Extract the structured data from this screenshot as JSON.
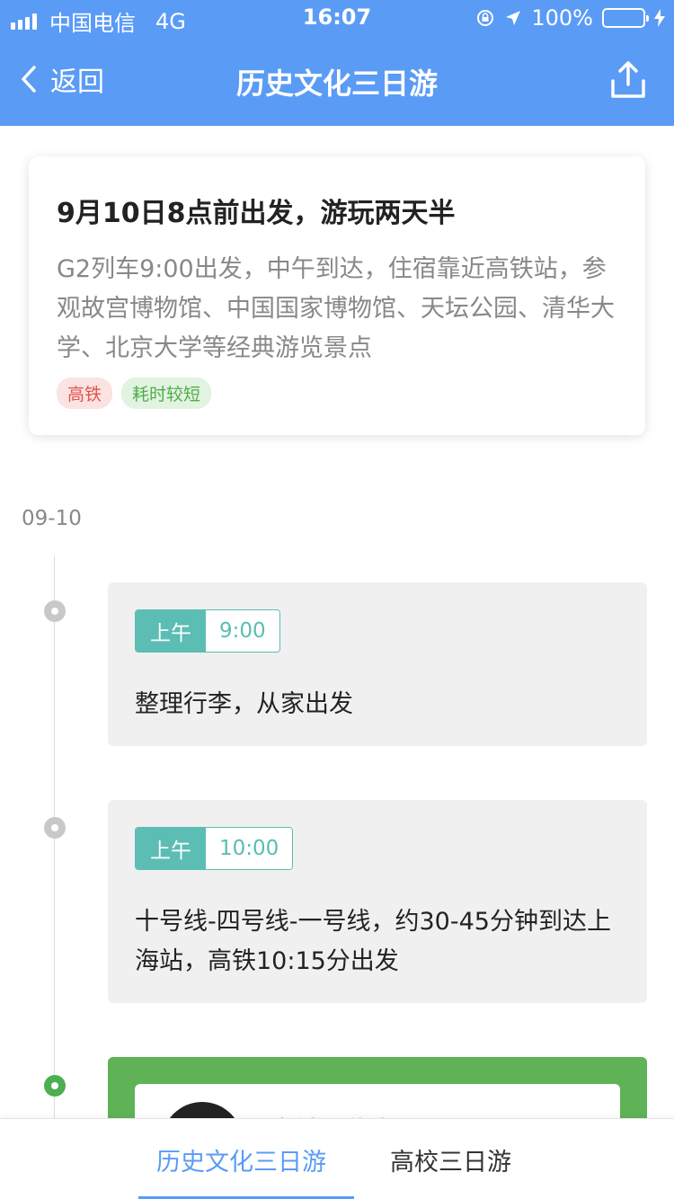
{
  "status_bar": {
    "carrier": "中国电信",
    "network": "4G",
    "time": "16:07",
    "battery": "100%",
    "battery_level": 1.0
  },
  "nav": {
    "back_label": "返回",
    "title": "历史文化三日游",
    "share_icon": "share-icon"
  },
  "summary": {
    "title": "9月10日8点前出发，游玩两天半",
    "description": "G2列车9:00出发，中午到达，住宿靠近高铁站，参观故宫博物馆、中国国家博物馆、天坛公园、清华大学、北京大学等经典游览景点",
    "tags": [
      "高铁",
      "耗时较短"
    ]
  },
  "date": "09-10",
  "events": [
    {
      "period": "上午",
      "time": "9:00",
      "text": "整理行李，从家出发"
    },
    {
      "period": "上午",
      "time": "10:00",
      "text": "十号线-四号线-一号线，约30-45分钟到达上海站，高铁10:15分出发"
    }
  ],
  "partial_card": {
    "title": "古城区住宿"
  },
  "tabs": [
    "历史文化三日游",
    "高校三日游"
  ],
  "colors": {
    "primary": "#5a9bf6",
    "teal": "#5bbdb3",
    "green": "#5fb356",
    "tag_red": "#e0554d",
    "tag_green": "#4fae4a"
  }
}
